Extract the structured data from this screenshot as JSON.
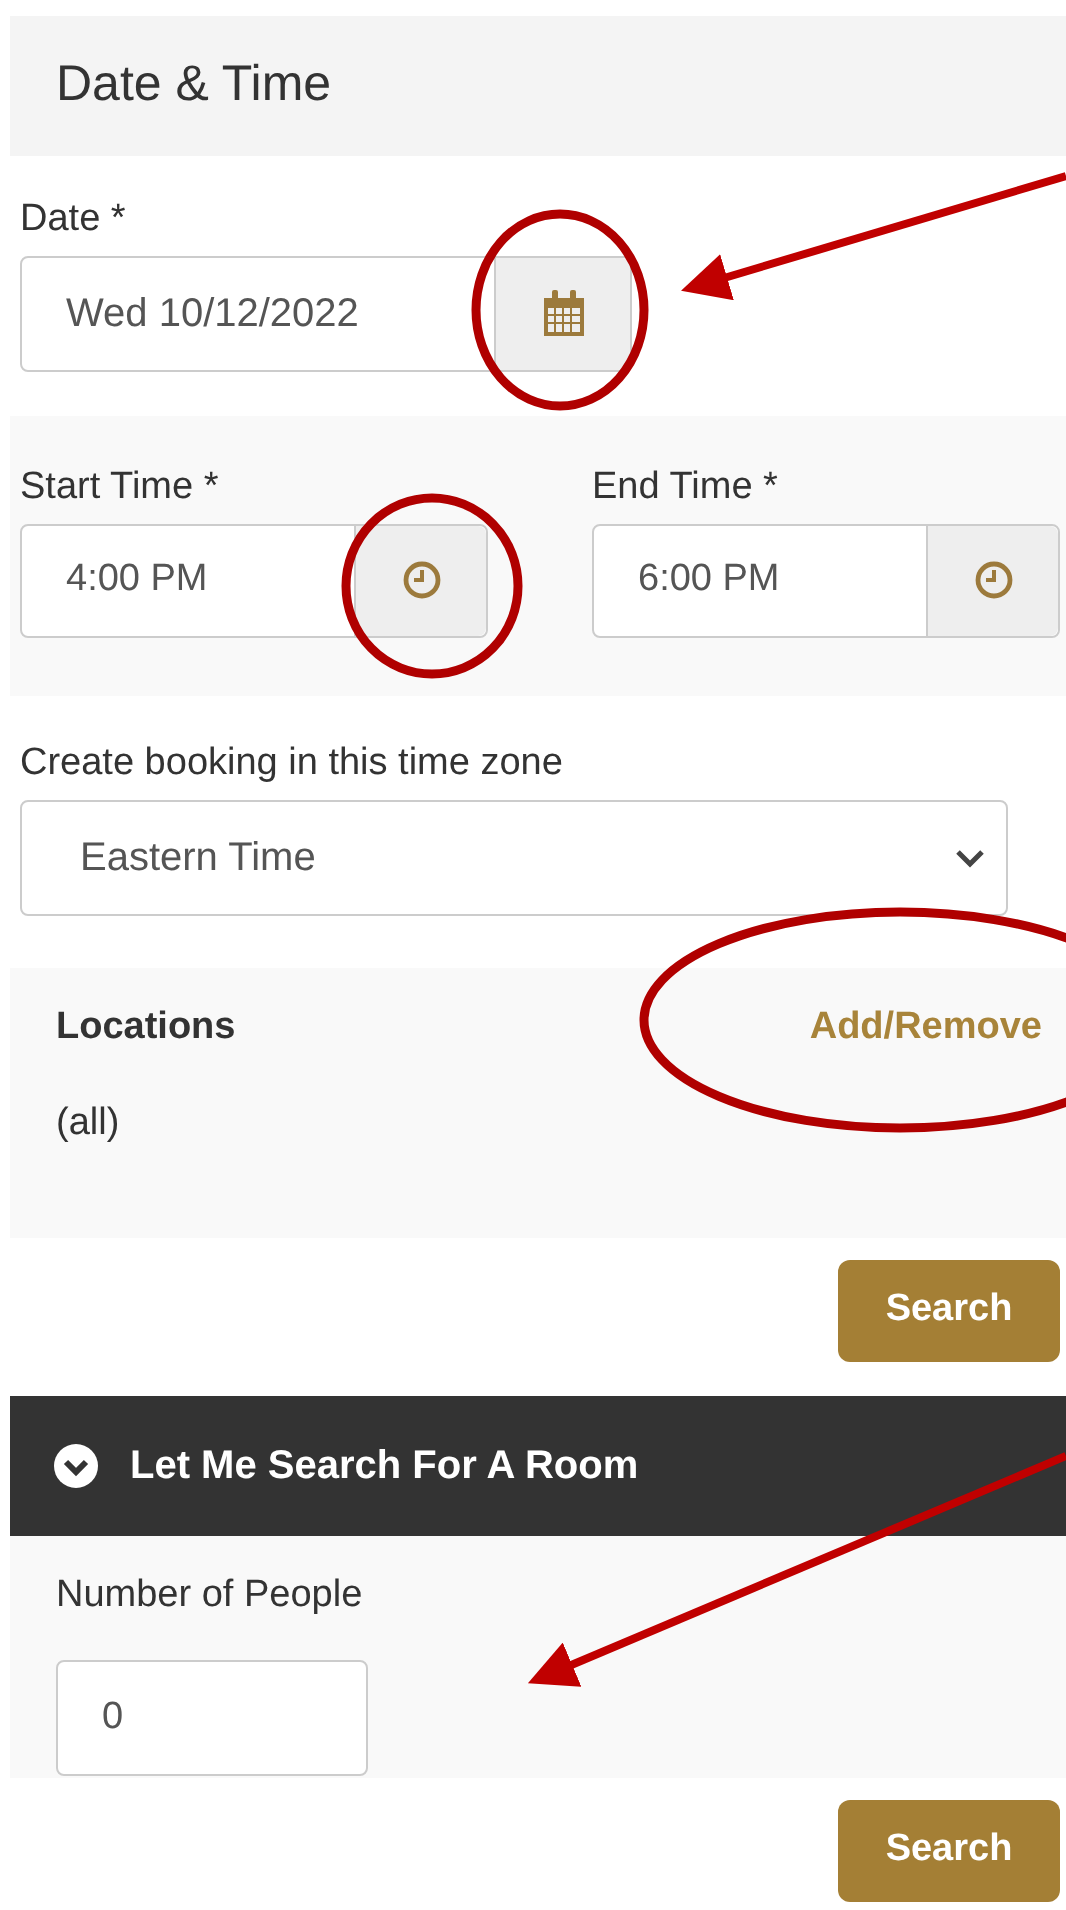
{
  "section_title": "Date & Time",
  "date": {
    "label": "Date *",
    "value": "Wed 10/12/2022"
  },
  "times": [
    {
      "label": "Start Time *",
      "value": "4:00 PM"
    },
    {
      "label": "End Time *",
      "value": "6:00 PM"
    }
  ],
  "time_zone": {
    "label": "Create booking in this time zone",
    "value": "Eastern Time"
  },
  "locations": {
    "title": "Locations",
    "link": "Add/Remove",
    "value": "(all)"
  },
  "search_button": "Search",
  "room_search": {
    "title": "Let Me Search For A Room",
    "expanded": true,
    "people_label": "Number of People",
    "people_value": "0",
    "search_button": "Search"
  }
}
